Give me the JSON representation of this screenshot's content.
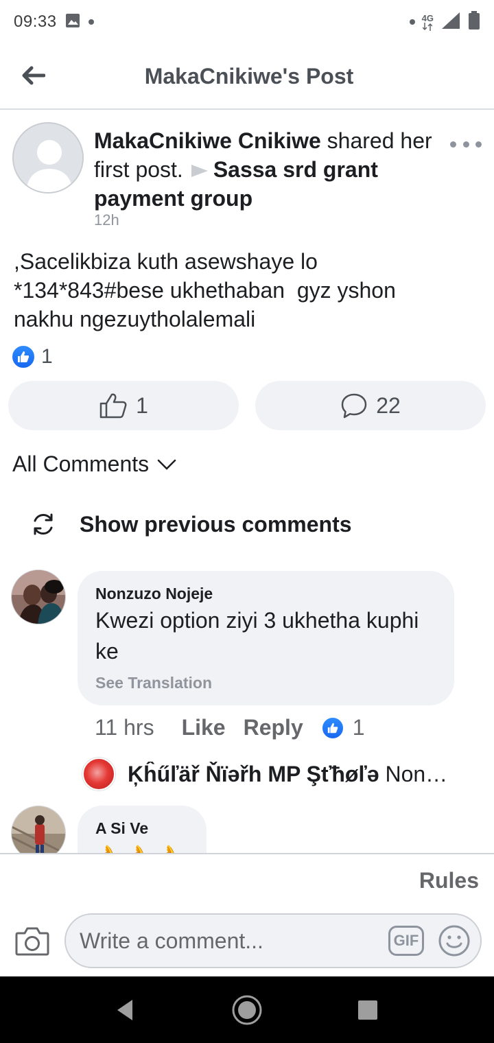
{
  "status_bar": {
    "time": "09:33",
    "network": "4G"
  },
  "header": {
    "title": "MakaCnikiwe's Post"
  },
  "post": {
    "author": "MakaCnikiwe Cnikiwe",
    "action_text": "shared her first post.",
    "group": "Sassa srd grant payment group",
    "time": "12h",
    "body": ",Sacelikbiza kuth asewshaye lo\n*134*843#bese ukhethaban  gyz yshon\nnakhu ngezuytholalemali",
    "reaction_count": "1",
    "like_button_count": "1",
    "comment_button_count": "22"
  },
  "comments_section": {
    "filter_label": "All Comments",
    "show_previous_label": "Show previous comments"
  },
  "comments": [
    {
      "name": "Nonzuzo Nojeje",
      "text": "Kwezi option ziyi 3 ukhetha kuphi ke",
      "translate_label": "See Translation",
      "time": "11 hrs",
      "like_label": "Like",
      "reply_label": "Reply",
      "like_count": "1",
      "reply_preview": {
        "name": "Ķĥűľäř Ňïəřh MP Şťħøľə",
        "text": "Nonzuzo Nojeje"
      }
    },
    {
      "name": "A Si Ve",
      "text": "👌👌👌"
    }
  ],
  "composer": {
    "rules_label": "Rules",
    "placeholder": "Write a comment...",
    "gif_label": "GIF"
  },
  "colors": {
    "like_blue": "#1877f2",
    "bubble_gray": "#f0f2f5",
    "muted_text": "#65676b"
  }
}
